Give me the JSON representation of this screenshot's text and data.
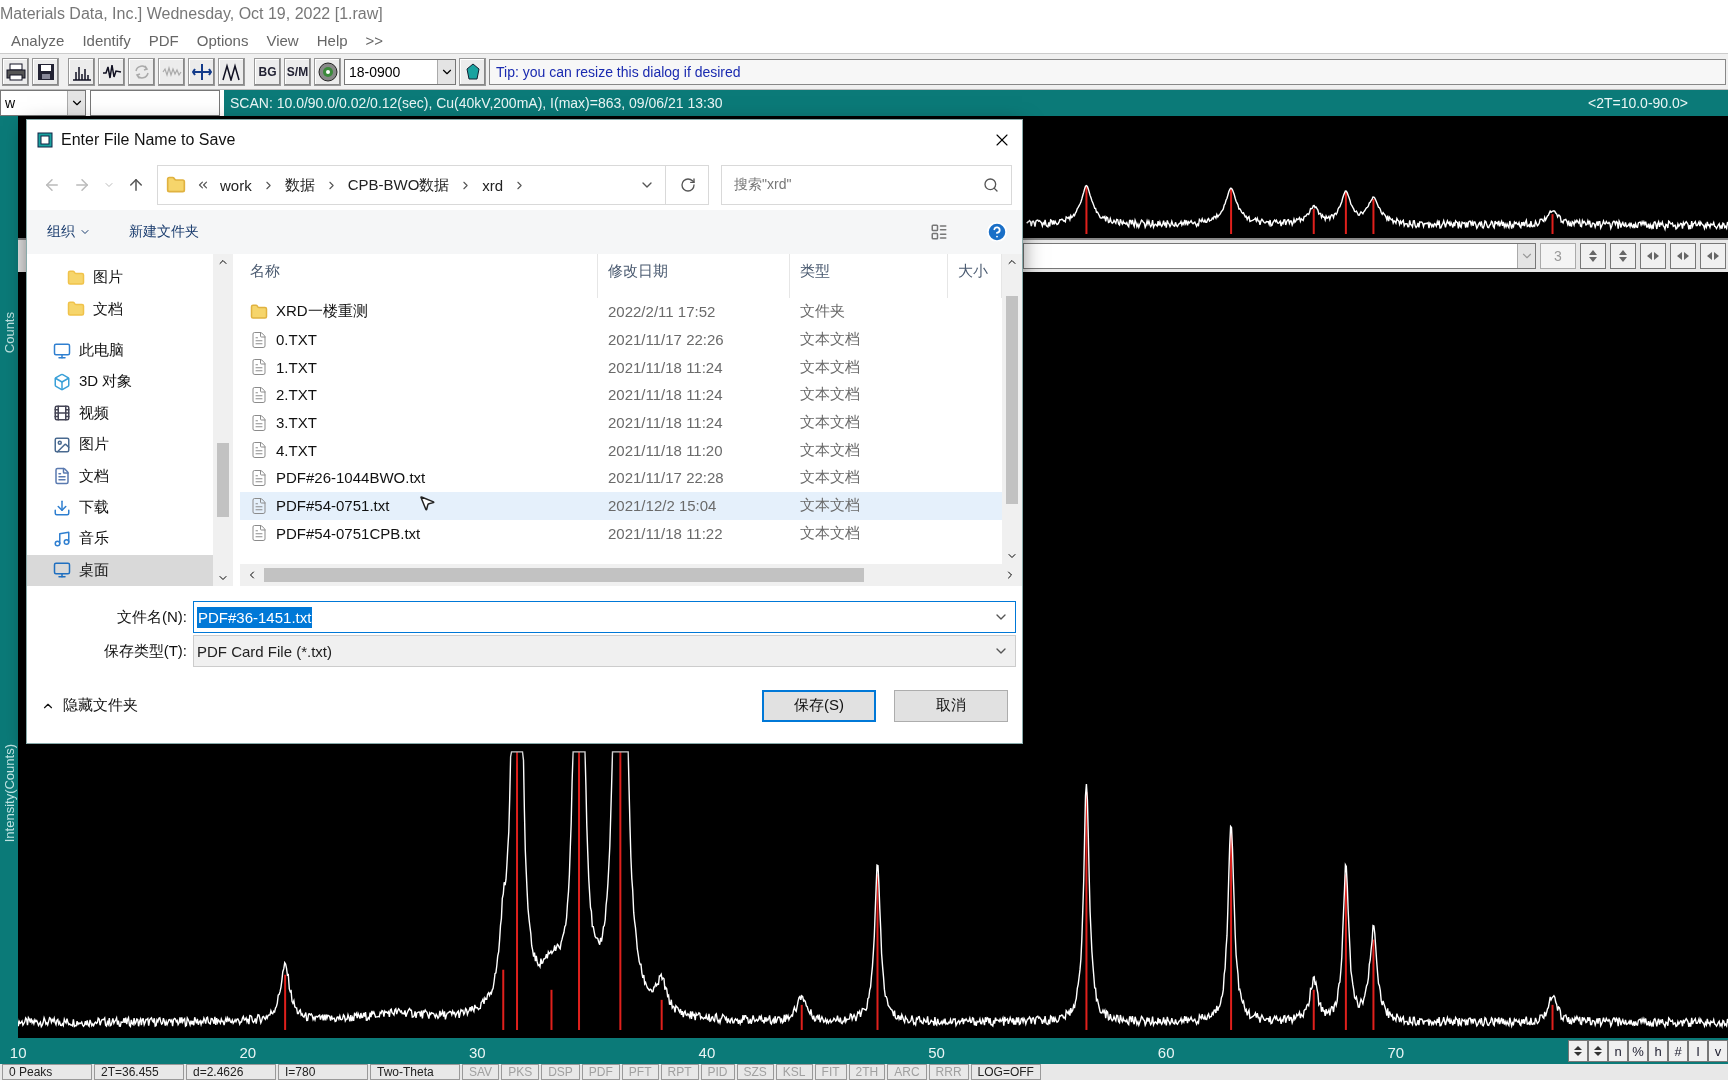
{
  "window": {
    "title": "Materials Data, Inc.] Wednesday, Oct 19, 2022 [1.raw]"
  },
  "menu": [
    "Analyze",
    "Identify",
    "PDF",
    "Options",
    "View",
    "Help",
    ">>"
  ],
  "toolbar": {
    "buttons": [
      {
        "kind": "print"
      },
      {
        "kind": "save"
      },
      {
        "kind": "peaks"
      },
      {
        "kind": "wave"
      },
      {
        "kind": "cycle",
        "disabled": true
      },
      {
        "kind": "noise",
        "disabled": true
      },
      {
        "kind": "arrows"
      },
      {
        "kind": "twin"
      },
      {
        "kind": "text",
        "label": "BG"
      },
      {
        "kind": "text",
        "label": "S/M"
      },
      {
        "kind": "disc"
      }
    ],
    "card_combo": "18-0900",
    "tip": "Tip: you can resize this dialog if desired"
  },
  "scan_bar": {
    "combo": "w",
    "info": "SCAN: 10.0/90.0/0.02/0.12(sec), Cu(40kV,200mA), I(max)=863, 09/06/21 13:30",
    "range": "<2T=10.0-90.0>"
  },
  "side_labels": {
    "upper": "Counts",
    "main": "Intensity(Counts)"
  },
  "zoom_controls": {
    "value": "3"
  },
  "x_axis": {
    "ticks": [
      "10",
      "20",
      "30",
      "40",
      "50",
      "60",
      "70"
    ]
  },
  "axis_buttons": [
    "n",
    "%",
    "h",
    "#",
    "I",
    "v"
  ],
  "status_bar": [
    {
      "label": "0 Peaks",
      "kind": "readout"
    },
    {
      "label": "2T=36.455",
      "kind": "readout"
    },
    {
      "label": "d=2.4626",
      "kind": "readout"
    },
    {
      "label": "I=780",
      "kind": "readout"
    },
    {
      "label": "Two-Theta",
      "kind": "readout"
    },
    {
      "label": "SAV",
      "kind": "toggle",
      "disabled": true
    },
    {
      "label": "PKS",
      "kind": "toggle",
      "disabled": true
    },
    {
      "label": "DSP",
      "kind": "toggle",
      "disabled": true
    },
    {
      "label": "PDF",
      "kind": "toggle",
      "disabled": true
    },
    {
      "label": "PFT",
      "kind": "toggle",
      "disabled": true
    },
    {
      "label": "RPT",
      "kind": "toggle",
      "disabled": true
    },
    {
      "label": "PID",
      "kind": "toggle",
      "disabled": true
    },
    {
      "label": "SZS",
      "kind": "toggle",
      "disabled": true
    },
    {
      "label": "KSL",
      "kind": "toggle",
      "disabled": true
    },
    {
      "label": "FIT",
      "kind": "toggle",
      "disabled": true
    },
    {
      "label": "2TH",
      "kind": "toggle",
      "disabled": true
    },
    {
      "label": "ARC",
      "kind": "toggle",
      "disabled": true
    },
    {
      "label": "RRR",
      "kind": "toggle",
      "disabled": true
    },
    {
      "label": "LOG=OFF",
      "kind": "toggle",
      "disabled": false
    }
  ],
  "dialog": {
    "title": "Enter File Name to Save",
    "path": [
      "work",
      "数据",
      "CPB-BWO数据",
      "xrd"
    ],
    "search_placeholder": "搜索\"xrd\"",
    "organize": "组织",
    "new_folder": "新建文件夹",
    "nav": [
      {
        "label": "图片",
        "kind": "folder",
        "selected": false
      },
      {
        "label": "文档",
        "kind": "folder",
        "selected": false
      },
      {
        "label": "此电脑",
        "kind": "pc",
        "selected": false
      },
      {
        "label": "3D 对象",
        "kind": "objects",
        "selected": false
      },
      {
        "label": "视频",
        "kind": "video",
        "selected": false
      },
      {
        "label": "图片",
        "kind": "pictures",
        "selected": false
      },
      {
        "label": "文档",
        "kind": "documents",
        "selected": false
      },
      {
        "label": "下载",
        "kind": "downloads",
        "selected": false
      },
      {
        "label": "音乐",
        "kind": "music",
        "selected": false
      },
      {
        "label": "桌面",
        "kind": "desktop",
        "selected": true
      }
    ],
    "columns": [
      "名称",
      "修改日期",
      "类型",
      "大小"
    ],
    "files": [
      {
        "name": "XRD一楼重测",
        "modified": "2022/2/11 17:52",
        "type": "文件夹",
        "kind": "folder",
        "selected": false
      },
      {
        "name": "0.TXT",
        "modified": "2021/11/17 22:26",
        "type": "文本文档",
        "kind": "file",
        "selected": false
      },
      {
        "name": "1.TXT",
        "modified": "2021/11/18 11:24",
        "type": "文本文档",
        "kind": "file",
        "selected": false
      },
      {
        "name": "2.TXT",
        "modified": "2021/11/18 11:24",
        "type": "文本文档",
        "kind": "file",
        "selected": false
      },
      {
        "name": "3.TXT",
        "modified": "2021/11/18 11:24",
        "type": "文本文档",
        "kind": "file",
        "selected": false
      },
      {
        "name": "4.TXT",
        "modified": "2021/11/18 11:20",
        "type": "文本文档",
        "kind": "file",
        "selected": false
      },
      {
        "name": "PDF#26-1044BWO.txt",
        "modified": "2021/11/17 22:28",
        "type": "文本文档",
        "kind": "file",
        "selected": false
      },
      {
        "name": "PDF#54-0751.txt",
        "modified": "2021/12/2 15:04",
        "type": "文本文档",
        "kind": "file",
        "selected": true
      },
      {
        "name": "PDF#54-0751CPB.txt",
        "modified": "2021/11/18 11:22",
        "type": "文本文档",
        "kind": "file",
        "selected": false
      }
    ],
    "filename_label": "文件名(N):",
    "filename": "PDF#36-1451.txt",
    "filetype_label": "保存类型(T):",
    "filetype": "PDF Card File (*.txt)",
    "hide_folders": "隐藏文件夹",
    "buttons": [
      {
        "label": "保存(S)",
        "kind": "primary"
      },
      {
        "label": "取消",
        "kind": "secondary"
      }
    ]
  }
}
